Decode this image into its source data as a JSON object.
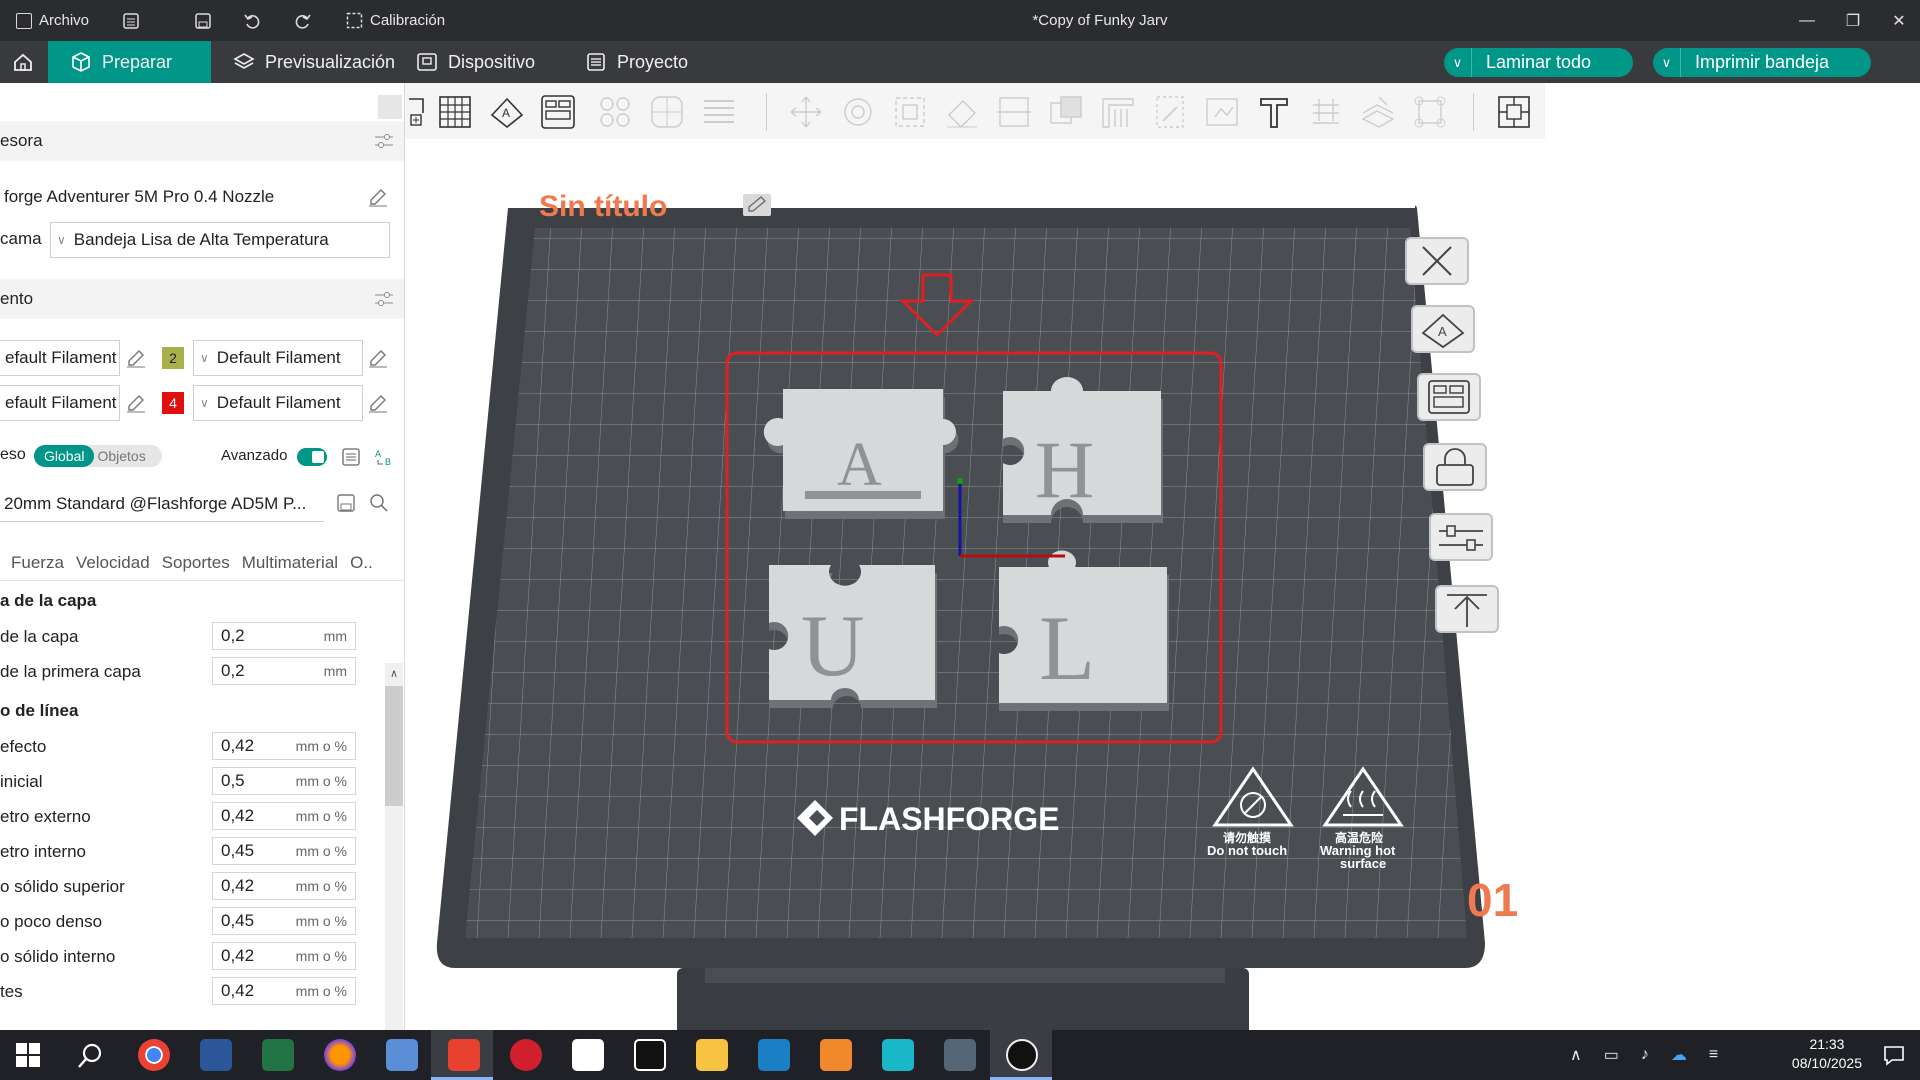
{
  "titlebar": {
    "file_menu": "Archivo",
    "calibration": "Calibración",
    "document_title": "*Copy of Funky Jarv"
  },
  "menubar": {
    "tabs": [
      {
        "label": "Preparar",
        "active": true
      },
      {
        "label": "Previsualización",
        "active": false
      },
      {
        "label": "Dispositivo",
        "active": false
      },
      {
        "label": "Proyecto",
        "active": false
      }
    ],
    "slice_all": "Laminar todo",
    "print_plate": "Imprimir bandeja"
  },
  "sidebar": {
    "printer_section": "esora",
    "printer_name": "forge Adventurer 5M Pro 0.4 Nozzle",
    "bed_label": "cama",
    "bed_type": "Bandeja Lisa de Alta Temperatura",
    "filament_section": "ento",
    "filaments": [
      {
        "left": "efault Filament",
        "num": "2",
        "num_color": "#a8b04a",
        "right": "Default Filament"
      },
      {
        "left": "efault Filament",
        "num": "4",
        "num_color": "#e01010",
        "right": "Default Filament"
      }
    ],
    "process_label": "eso",
    "toggle_global": "Global",
    "toggle_objects": "Objetos",
    "advanced_label": "Avanzado",
    "process_profile": "20mm Standard @Flashforge AD5M P...",
    "tabs": [
      "Fuerza",
      "Velocidad",
      "Soportes",
      "Multimaterial",
      "O.."
    ],
    "groups": [
      {
        "title": "a de la capa",
        "params": [
          {
            "label": "de la capa",
            "value": "0,2",
            "unit": "mm"
          },
          {
            "label": "de la primera capa",
            "value": "0,2",
            "unit": "mm"
          }
        ]
      },
      {
        "title": "o de línea",
        "params": [
          {
            "label": "efecto",
            "value": "0,42",
            "unit": "mm o %"
          },
          {
            "label": "inicial",
            "value": "0,5",
            "unit": "mm o %"
          },
          {
            "label": "etro externo",
            "value": "0,42",
            "unit": "mm o %"
          },
          {
            "label": "etro interno",
            "value": "0,45",
            "unit": "mm o %"
          },
          {
            "label": "o sólido superior",
            "value": "0,42",
            "unit": "mm o %"
          },
          {
            "label": "o poco denso",
            "value": "0,45",
            "unit": "mm o %"
          },
          {
            "label": "o sólido interno",
            "value": "0,42",
            "unit": "mm o %"
          },
          {
            "label": "tes",
            "value": "0,42",
            "unit": "mm o %"
          }
        ]
      }
    ]
  },
  "viewport": {
    "plate_title": "Sin título",
    "brand": "FLASHFORGE",
    "warn1_cn": "请勿触摸",
    "warn1_en": "Do not touch",
    "warn2_cn": "高温危险",
    "warn2_en_1": "Warning hot",
    "warn2_en_2": "surface",
    "plate_number": "01",
    "pieces": [
      "A",
      "H",
      "U",
      "L"
    ]
  },
  "taskbar": {
    "time": "21:33",
    "date": "08/10/2025"
  },
  "colors": {
    "accent": "#009688",
    "plate_dark": "#3d4044",
    "grid_line": "#8a8f94",
    "selection": "#e02020",
    "title_orange": "#f07a50"
  }
}
